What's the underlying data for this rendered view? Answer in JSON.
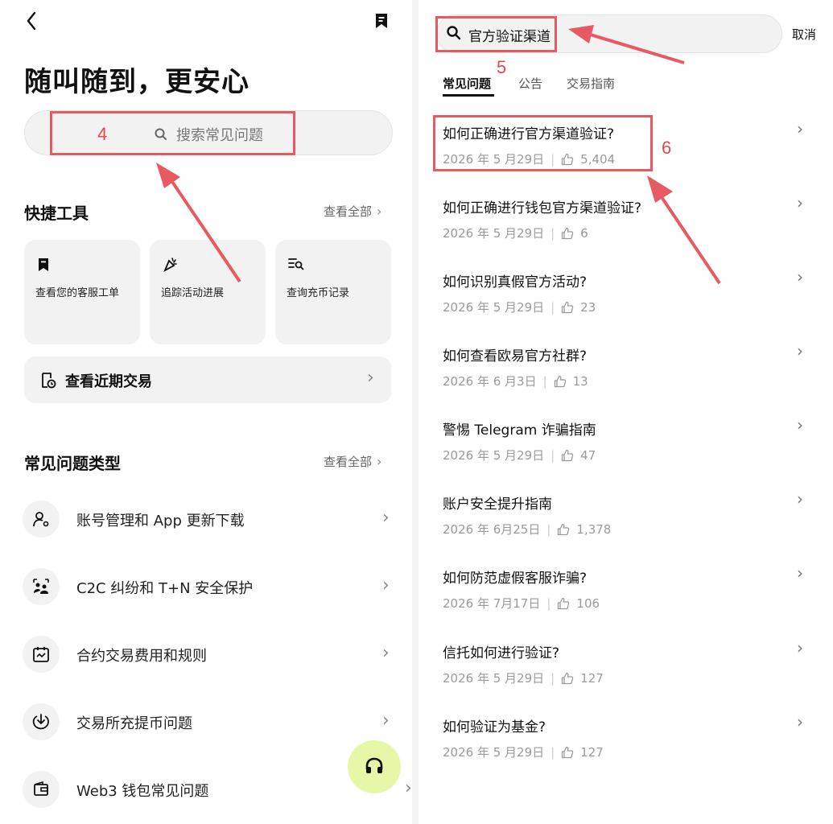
{
  "left": {
    "title": "随叫随到，更安心",
    "search_placeholder": "搜索常见问题",
    "quick_tools": {
      "title": "快捷工具",
      "see_all": "查看全部",
      "items": [
        {
          "label": "查看您的客服工单",
          "icon": "ticket-icon"
        },
        {
          "label": "追踪活动进展",
          "icon": "party-popper-icon"
        },
        {
          "label": "查询充币记录",
          "icon": "list-search-icon"
        }
      ],
      "recent_trades": "查看近期交易"
    },
    "faq_types": {
      "title": "常见问题类型",
      "see_all": "查看全部",
      "items": [
        {
          "label": "账号管理和 App 更新下载",
          "icon": "user-gear-icon"
        },
        {
          "label": "C2C 纠纷和 T+N 安全保护",
          "icon": "people-shield-icon"
        },
        {
          "label": "合约交易费用和规则",
          "icon": "calendar-chart-icon"
        },
        {
          "label": "交易所充提币问题",
          "icon": "download-circle-icon"
        },
        {
          "label": "Web3 钱包常见问题",
          "icon": "wallet-icon"
        }
      ]
    }
  },
  "right": {
    "search_value": "官方验证渠道",
    "cancel": "取消",
    "tabs": [
      "常见问题",
      "公告",
      "交易指南"
    ],
    "questions": [
      {
        "title": "如何正确进行官方渠道验证?",
        "date": "2026 年 5 月29日",
        "likes": "5,404"
      },
      {
        "title": "如何正确进行钱包官方渠道验证?",
        "date": "2026 年 5 月29日",
        "likes": "6"
      },
      {
        "title": "如何识别真假官方活动?",
        "date": "2026 年 5 月29日",
        "likes": "23"
      },
      {
        "title": "如何查看欧易官方社群?",
        "date": "2026 年 6 月3日",
        "likes": "13"
      },
      {
        "title": "警惕 Telegram 诈骗指南",
        "date": "2026 年 5 月29日",
        "likes": "47"
      },
      {
        "title": "账户安全提升指南",
        "date": "2026 年 6月25日",
        "likes": "1,378"
      },
      {
        "title": "如何防范虚假客服诈骗?",
        "date": "2026 年 7月17日",
        "likes": "106"
      },
      {
        "title": "信托如何进行验证?",
        "date": "2026 年 5 月29日",
        "likes": "127"
      },
      {
        "title": "如何验证为基金?",
        "date": "2026 年 5 月29日",
        "likes": "127"
      }
    ]
  },
  "annotations": {
    "n4": "4",
    "n5": "5",
    "n6": "6"
  },
  "colors": {
    "annotation": "#e85a61",
    "fab": "#e6f7a8",
    "accent": "#111111"
  }
}
